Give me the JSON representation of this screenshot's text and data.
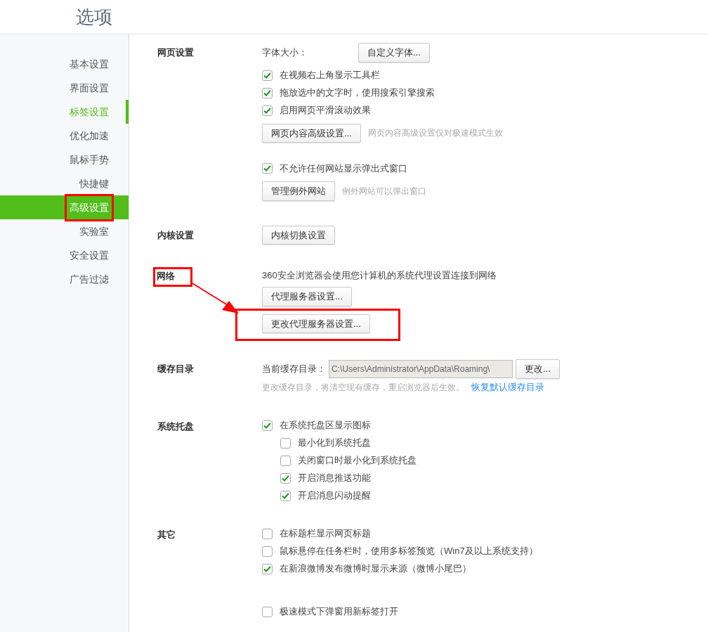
{
  "window": {
    "title": "选项"
  },
  "sidebar": {
    "items": [
      {
        "label": "基本设置",
        "selected": false,
        "accent": false,
        "highlighted": false
      },
      {
        "label": "界面设置",
        "selected": false,
        "accent": false,
        "highlighted": false
      },
      {
        "label": "标签设置",
        "selected": false,
        "accent": true,
        "highlighted": false
      },
      {
        "label": "优化加速",
        "selected": false,
        "accent": false,
        "highlighted": false
      },
      {
        "label": "鼠标手势",
        "selected": false,
        "accent": false,
        "highlighted": false
      },
      {
        "label": "快捷键",
        "selected": false,
        "accent": false,
        "highlighted": false
      },
      {
        "label": "高级设置",
        "selected": true,
        "accent": false,
        "highlighted": true
      },
      {
        "label": "实验室",
        "selected": false,
        "accent": false,
        "highlighted": false
      },
      {
        "label": "安全设置",
        "selected": false,
        "accent": false,
        "highlighted": false
      },
      {
        "label": "广告过滤",
        "selected": false,
        "accent": false,
        "highlighted": false
      }
    ]
  },
  "sections": [
    {
      "title": "网页设置",
      "highlighted": false,
      "arrow": false,
      "rows": [
        {
          "kind": "label-button",
          "label": "字体大小：",
          "button": "自定义字体..."
        },
        {
          "kind": "checkbox",
          "label": "在视频右上角显示工具栏",
          "checked": true,
          "indented": false
        },
        {
          "kind": "checkbox",
          "label": "拖放选中的文字时，使用搜索引擎搜索",
          "checked": true,
          "indented": false
        },
        {
          "kind": "checkbox",
          "label": "启用网页平滑滚动效果",
          "checked": true,
          "indented": false
        },
        {
          "kind": "button-note",
          "button": "网页内容高级设置...",
          "note": "网页内容高级设置仅对极速模式生效"
        },
        {
          "kind": "spacer"
        },
        {
          "kind": "checkbox",
          "label": "不允许任何网站显示弹出式窗口",
          "checked": true,
          "indented": false
        },
        {
          "kind": "button-note",
          "button": "管理例外网站",
          "note": "例外网站可以弹出窗口"
        }
      ]
    },
    {
      "title": "内核设置",
      "highlighted": false,
      "arrow": false,
      "rows": [
        {
          "kind": "button",
          "button": "内核切换设置",
          "highlighted": false
        }
      ]
    },
    {
      "title": "网络",
      "highlighted": true,
      "arrow": true,
      "rows": [
        {
          "kind": "text",
          "label": "360安全浏览器会使用您计算机的系统代理设置连接到网络"
        },
        {
          "kind": "button",
          "button": "代理服务器设置...",
          "highlighted": false
        },
        {
          "kind": "button",
          "button": "更改代理服务器设置...",
          "highlighted": true
        }
      ]
    },
    {
      "title": "缓存目录",
      "highlighted": false,
      "arrow": false,
      "rows": [
        {
          "kind": "path",
          "label": "当前缓存目录：",
          "value": "C:\\Users\\Administrator\\AppData\\Roaming\\",
          "button": "更改..."
        },
        {
          "kind": "note-link",
          "note": "更改缓存目录，将清空现有缓存，重启浏览器后生效。",
          "link": "恢复默认缓存目录"
        }
      ]
    },
    {
      "title": "系统托盘",
      "highlighted": false,
      "arrow": false,
      "rows": [
        {
          "kind": "checkbox",
          "label": "在系统托盘区显示图标",
          "checked": true,
          "indented": false
        },
        {
          "kind": "checkbox",
          "label": "最小化到系统托盘",
          "checked": false,
          "indented": true
        },
        {
          "kind": "checkbox",
          "label": "关闭窗口时最小化到系统托盘",
          "checked": false,
          "indented": true
        },
        {
          "kind": "checkbox",
          "label": "开启消息推送功能",
          "checked": true,
          "indented": true
        },
        {
          "kind": "checkbox",
          "label": "开启消息闪动提醒",
          "checked": true,
          "indented": true
        }
      ]
    },
    {
      "title": "其它",
      "highlighted": false,
      "arrow": false,
      "rows": [
        {
          "kind": "checkbox",
          "label": "在标题栏显示网页标题",
          "checked": false,
          "indented": false
        },
        {
          "kind": "checkbox",
          "label": "鼠标悬停在任务栏时，使用多标签预览（Win7及以上系统支持）",
          "checked": false,
          "indented": false
        },
        {
          "kind": "checkbox",
          "label": "在新浪微博发布微博时显示来源（微博小尾巴）",
          "checked": true,
          "indented": false
        },
        {
          "kind": "spacer"
        },
        {
          "kind": "spacer"
        },
        {
          "kind": "checkbox",
          "label": "极速模式下弹窗用新标签打开",
          "checked": false,
          "indented": false
        }
      ]
    }
  ]
}
